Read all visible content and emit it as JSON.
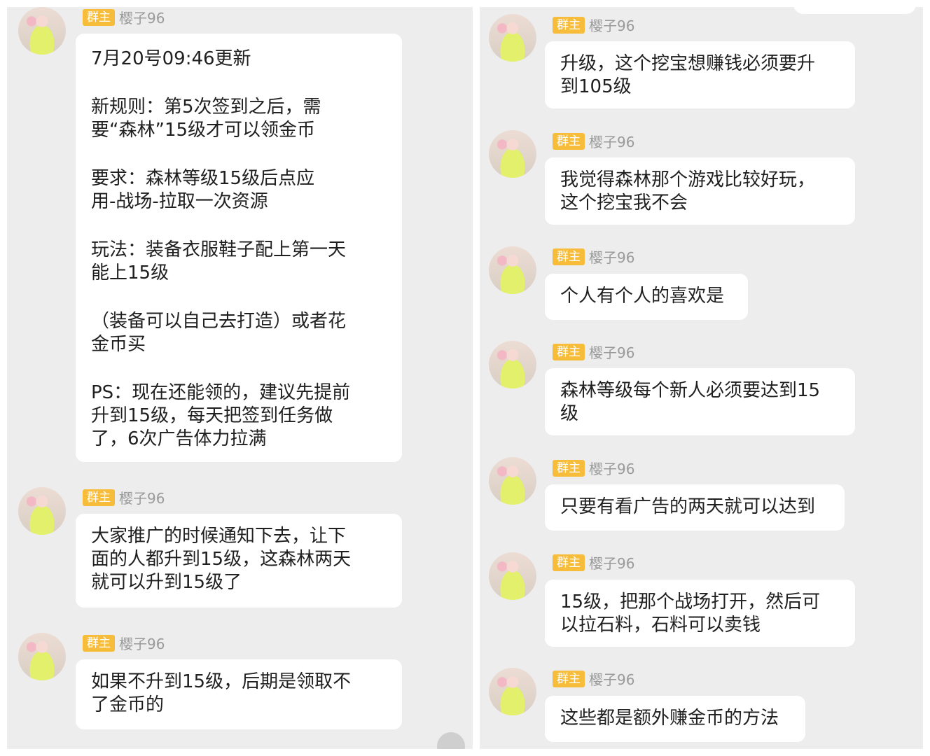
{
  "left": {
    "messages": [
      {
        "badge": "群主",
        "name": "樱子96",
        "paragraphs": [
          "7月20号09:46更新",
          "新规则：第5次签到之后，需\n要“森林”15级才可以领金币",
          "要求：森林等级15级后点应\n用-战场-拉取一次资源",
          "玩法：装备衣服鞋子配上第一天\n能上15级",
          "（装备可以自己去打造）或者花\n金币买",
          "PS：现在还能领的，建议先提前\n升到15级，每天把签到任务做\n了，6次广告体力拉满"
        ]
      },
      {
        "badge": "群主",
        "name": "樱子96",
        "paragraphs": [
          "大家推广的时候通知下去，让下\n面的人都升到15级，这森林两天\n就可以升到15级了"
        ]
      },
      {
        "badge": "群主",
        "name": "樱子96",
        "paragraphs": [
          "如果不升到15级，后期是领取不\n了金币的"
        ]
      }
    ]
  },
  "right": {
    "messages": [
      {
        "badge": "群主",
        "name": "樱子96",
        "paragraphs": [
          "升级，这个挖宝想赚钱必须要升\n到105级"
        ]
      },
      {
        "badge": "群主",
        "name": "樱子96",
        "paragraphs": [
          "我觉得森林那个游戏比较好玩，\n这个挖宝我不会"
        ]
      },
      {
        "badge": "群主",
        "name": "樱子96",
        "paragraphs": [
          "个人有个人的喜欢是"
        ]
      },
      {
        "badge": "群主",
        "name": "樱子96",
        "paragraphs": [
          "森林等级每个新人必须要达到15\n级"
        ]
      },
      {
        "badge": "群主",
        "name": "樱子96",
        "paragraphs": [
          "只要有看广告的两天就可以达到"
        ]
      },
      {
        "badge": "群主",
        "name": "樱子96",
        "paragraphs": [
          "15级，把那个战场打开，然后可\n以拉石料，石料可以卖钱"
        ]
      },
      {
        "badge": "群主",
        "name": "樱子96",
        "paragraphs": [
          "这些都是额外赚金币的方法"
        ]
      }
    ]
  }
}
